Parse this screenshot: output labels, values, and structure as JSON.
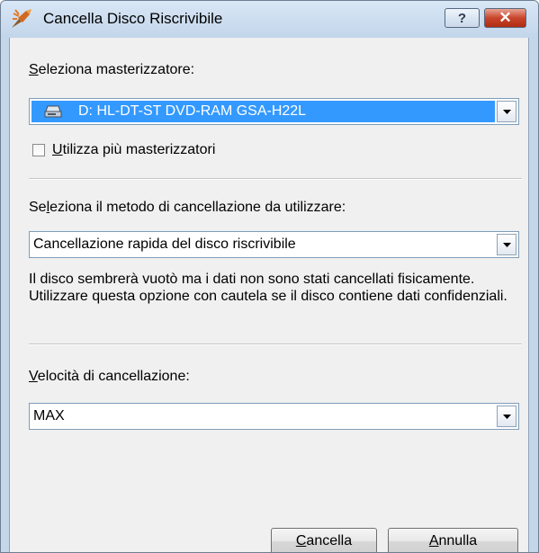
{
  "window": {
    "title": "Cancella Disco Riscrivibile",
    "help_label": "?",
    "close_label": "✕"
  },
  "recorder": {
    "label_accel": "S",
    "label_rest": "eleziona masterizzatore:",
    "selected": "D: HL-DT-ST DVD-RAM GSA-H22L"
  },
  "multi_recorder": {
    "label_accel": "U",
    "label_rest": "tilizza più masterizzatori",
    "checked": false
  },
  "method": {
    "label_pre": "Se",
    "label_accel": "l",
    "label_rest": "eziona il metodo di cancellazione da utilizzare:",
    "selected": "Cancellazione rapida del disco riscrivibile",
    "description": "Il disco sembrerà vuotò ma i dati non sono stati cancellati fisicamente. Utilizzare questa opzione con cautela se il disco contiene dati confidenziali."
  },
  "speed": {
    "label_accel": "V",
    "label_rest": "elocità di cancellazione:",
    "selected": "MAX"
  },
  "buttons": {
    "ok_accel": "C",
    "ok_rest": "ancella",
    "cancel_accel": "A",
    "cancel_rest": "nnulla"
  },
  "colors": {
    "selection": "#3399ff",
    "close_button": "#c8452c"
  }
}
